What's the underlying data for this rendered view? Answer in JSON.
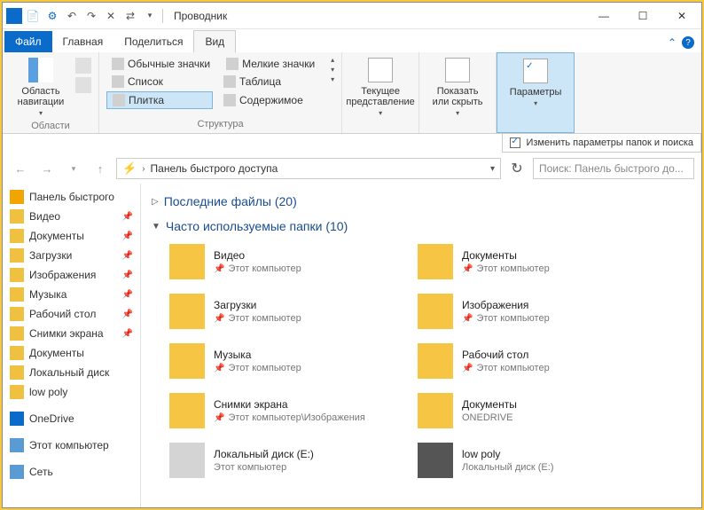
{
  "window": {
    "title": "Проводник"
  },
  "tabs": {
    "file": "Файл",
    "home": "Главная",
    "share": "Поделиться",
    "view": "Вид"
  },
  "ribbon": {
    "region": {
      "navpane": "Область\nнавигации",
      "label": "Области"
    },
    "layout": {
      "items": {
        "normal": "Обычные значки",
        "small": "Мелкие значки",
        "list": "Список",
        "table": "Таблица",
        "tiles": "Плитка",
        "content": "Содержимое"
      },
      "label": "Структура"
    },
    "currentview": {
      "btn": "Текущее\nпредставление"
    },
    "showhide": {
      "btn": "Показать\nили скрыть"
    },
    "options": {
      "btn": "Параметры",
      "tip": "Изменить параметры папок и поиска"
    }
  },
  "addressbar": {
    "path": "Панель быстрого доступа"
  },
  "search": {
    "placeholder": "Поиск: Панель быстрого до..."
  },
  "sidebar": {
    "quick": "Панель быстрого",
    "items": [
      {
        "label": "Видео",
        "pinned": true
      },
      {
        "label": "Документы",
        "pinned": true
      },
      {
        "label": "Загрузки",
        "pinned": true
      },
      {
        "label": "Изображения",
        "pinned": true
      },
      {
        "label": "Музыка",
        "pinned": true
      },
      {
        "label": "Рабочий стол",
        "pinned": true
      },
      {
        "label": "Снимки экрана",
        "pinned": true
      },
      {
        "label": "Документы",
        "pinned": false
      },
      {
        "label": "Локальный диск",
        "pinned": false
      },
      {
        "label": "low poly",
        "pinned": false
      }
    ],
    "onedrive": "OneDrive",
    "thispc": "Этот компьютер",
    "network": "Сеть"
  },
  "main": {
    "recent": {
      "title": "Последние файлы (20)"
    },
    "frequent": {
      "title": "Часто используемые папки (10)"
    },
    "folders": [
      {
        "name": "Видео",
        "loc": "Этот компьютер",
        "pinned": true,
        "kind": "video"
      },
      {
        "name": "Документы",
        "loc": "Этот компьютер",
        "pinned": true,
        "kind": "docs"
      },
      {
        "name": "Загрузки",
        "loc": "Этот компьютер",
        "pinned": true,
        "kind": "downloads"
      },
      {
        "name": "Изображения",
        "loc": "Этот компьютер",
        "pinned": true,
        "kind": "pictures"
      },
      {
        "name": "Музыка",
        "loc": "Этот компьютер",
        "pinned": true,
        "kind": "music"
      },
      {
        "name": "Рабочий стол",
        "loc": "Этот компьютер",
        "pinned": true,
        "kind": "desktop"
      },
      {
        "name": "Снимки экрана",
        "loc": "Этот компьютер\\Изображения",
        "pinned": true,
        "kind": "screens"
      },
      {
        "name": "Документы",
        "loc": "ONEDRIVE",
        "pinned": false,
        "kind": "onedocs"
      },
      {
        "name": "Локальный диск (E:)",
        "loc": "Этот компьютер",
        "pinned": false,
        "kind": "drive"
      },
      {
        "name": "low poly",
        "loc": "Локальный диск (E:)",
        "pinned": false,
        "kind": "lowpoly"
      }
    ]
  }
}
